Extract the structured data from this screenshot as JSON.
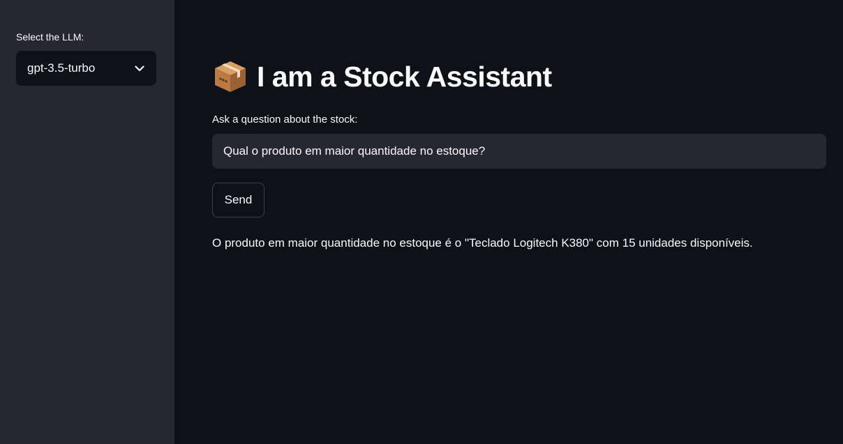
{
  "sidebar": {
    "select_label": "Select the LLM:",
    "selected_model": "gpt-3.5-turbo",
    "chevron_icon": "chevron-down-icon"
  },
  "main": {
    "title_icon": "package-icon",
    "title": "I am a Stock Assistant",
    "question_label": "Ask a question about the stock:",
    "question_value": "Qual o produto em maior quantidade no estoque?",
    "send_label": "Send",
    "answer": "O produto em maior quantidade no estoque é o \"Teclado Logitech K380\" com 15 unidades disponíveis."
  },
  "colors": {
    "sidebar_bg": "#262730",
    "main_bg": "#0e1117",
    "input_bg": "#262730",
    "text": "#fafafa",
    "button_border": "#3f414a"
  }
}
